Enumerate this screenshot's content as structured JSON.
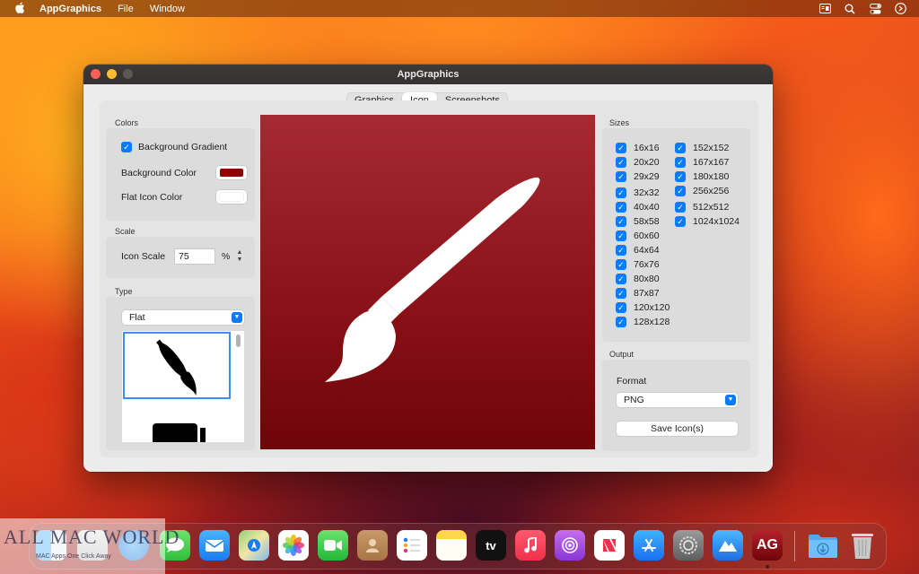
{
  "menubar": {
    "app_name": "AppGraphics",
    "menus": [
      "File",
      "Window"
    ]
  },
  "window": {
    "title": "AppGraphics",
    "tabs": [
      "Graphics",
      "Icon",
      "Screenshots"
    ],
    "active_tab": "Icon"
  },
  "colors": {
    "section_title": "Colors",
    "background_gradient_label": "Background Gradient",
    "background_gradient_checked": true,
    "background_color_label": "Background Color",
    "background_color_value": "#8b0000",
    "flat_icon_color_label": "Flat Icon Color",
    "flat_icon_color_value": "#ffffff"
  },
  "scale": {
    "section_title": "Scale",
    "icon_scale_label": "Icon Scale",
    "icon_scale_value": "75",
    "unit": "%"
  },
  "type": {
    "section_title": "Type",
    "selected": "Flat",
    "icons": [
      "paintbrush-icon",
      "marker-icon"
    ]
  },
  "sizes": {
    "section_title": "Sizes",
    "column1": [
      "16x16",
      "20x20",
      "29x29",
      "32x32",
      "40x40",
      "58x58",
      "60x60",
      "64x64",
      "76x76",
      "80x80",
      "87x87",
      "120x120",
      "128x128"
    ],
    "column2": [
      "152x152",
      "167x167",
      "180x180",
      "256x256",
      "512x512",
      "1024x1024"
    ],
    "all_checked": true
  },
  "output": {
    "section_title": "Output",
    "format_label": "Format",
    "format_value": "PNG",
    "save_button": "Save Icon(s)"
  },
  "watermark": {
    "brand": "ALL MAC WORLD",
    "tagline": "MAC Apps One Click Away"
  },
  "dock": {
    "apps": [
      "Finder",
      "Launchpad",
      "Safari",
      "Messages",
      "Mail",
      "Maps",
      "Photos",
      "FaceTime",
      "Contacts",
      "Reminders",
      "Notes",
      "TV",
      "Music",
      "Podcasts",
      "News",
      "App Store",
      "System Settings",
      "Creative app",
      "AppGraphics",
      "Downloads",
      "Trash"
    ],
    "tv_label": "tv",
    "appgraphics_label": "AG"
  }
}
